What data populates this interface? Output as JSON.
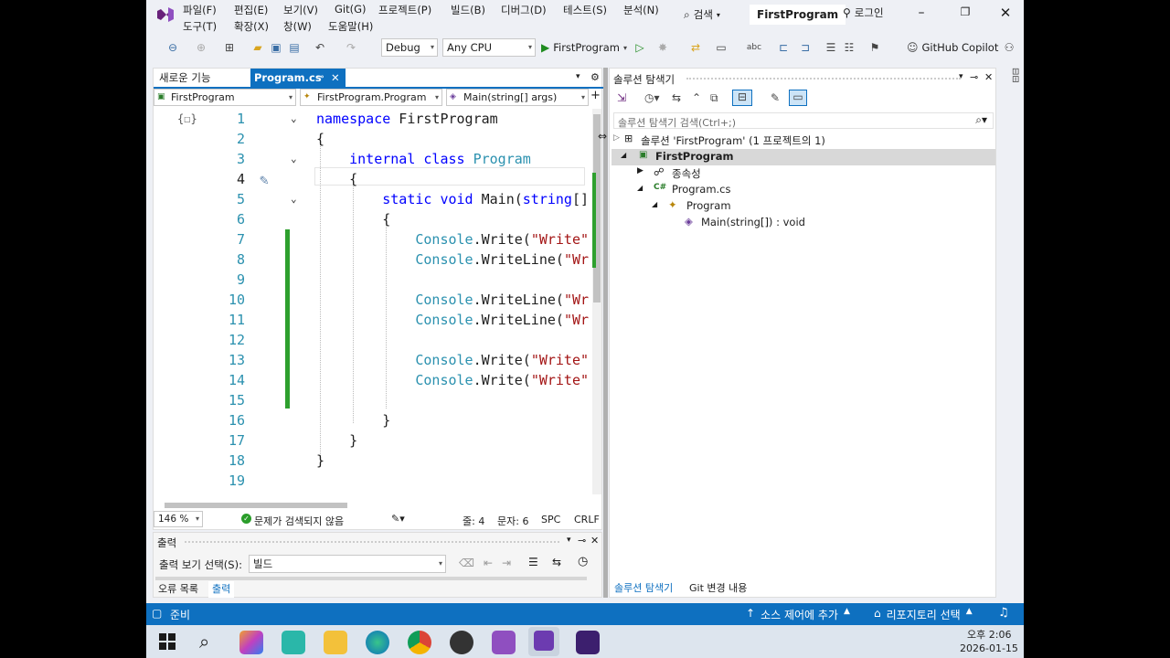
{
  "menu": {
    "file": "파일(F)",
    "edit": "편집(E)",
    "view": "보기(V)",
    "git": "Git(G)",
    "project": "프로젝트(P)",
    "build": "빌드(B)",
    "debug": "디버그(D)",
    "test": "테스트(S)",
    "analyze": "분석(N)",
    "tools": "도구(T)",
    "extensions": "확장(X)",
    "window": "창(W)",
    "help": "도움말(H)",
    "search": "검색",
    "solution_name": "FirstProgram",
    "login": "로그인"
  },
  "toolbar": {
    "config": "Debug",
    "platform": "Any CPU",
    "run_target": "FirstProgram",
    "copilot": "GitHub Copilot"
  },
  "tabs": {
    "new_features": "새로운 기능",
    "active_file": "Program.cs"
  },
  "nav": {
    "project": "FirstProgram",
    "class": "FirstProgram.Program",
    "member": "Main(string[] args)"
  },
  "code_lines": [
    {
      "n": "1",
      "html": "namespace FirstProgram"
    },
    {
      "n": "2",
      "html": "{"
    },
    {
      "n": "3",
      "html": "    internal class Program"
    },
    {
      "n": "4",
      "html": "    {"
    },
    {
      "n": "5",
      "html": "        static void Main(string[]"
    },
    {
      "n": "6",
      "html": "        {"
    },
    {
      "n": "7",
      "html": "            Console.Write(\"Write\""
    },
    {
      "n": "8",
      "html": "            Console.WriteLine(\"Wr"
    },
    {
      "n": "9",
      "html": ""
    },
    {
      "n": "10",
      "html": "            Console.WriteLine(\"Wr"
    },
    {
      "n": "11",
      "html": "            Console.WriteLine(\"Wr"
    },
    {
      "n": "12",
      "html": ""
    },
    {
      "n": "13",
      "html": "            Console.Write(\"Write\""
    },
    {
      "n": "14",
      "html": "            Console.Write(\"Write\""
    },
    {
      "n": "15",
      "html": ""
    },
    {
      "n": "16",
      "html": "        }"
    },
    {
      "n": "17",
      "html": "    }"
    },
    {
      "n": "18",
      "html": "}"
    },
    {
      "n": "19",
      "html": ""
    }
  ],
  "editor_status": {
    "zoom": "146 %",
    "issues": "문제가 검색되지 않음",
    "line": "줄: 4",
    "col": "문자: 6",
    "spc": "SPC",
    "crlf": "CRLF"
  },
  "output": {
    "title": "출력",
    "show_from_label": "출력 보기 선택(S):",
    "show_from_value": "빌드",
    "tab_errors": "오류 목록",
    "tab_output": "출력"
  },
  "solution_explorer": {
    "title": "솔루션 탐색기",
    "search_placeholder": "솔루션 탐색기 검색(Ctrl+;)",
    "solution": "솔루션 'FirstProgram' (1 프로젝트의 1)",
    "project": "FirstProgram",
    "dependencies": "종속성",
    "file": "Program.cs",
    "class": "Program",
    "method": "Main(string[]) : void",
    "tab_se": "솔루션 탐색기",
    "tab_git": "Git 변경 내용"
  },
  "statusbar": {
    "ready": "준비",
    "source_control": "소스 제어에 추가",
    "repo": "리포지토리 선택"
  },
  "clock": {
    "time": "오후 2:06",
    "date": "2026-01-15"
  },
  "colors": {
    "accent": "#0e70c0",
    "change_bar": "#2ea02e",
    "vs_purple": "#68217a"
  }
}
